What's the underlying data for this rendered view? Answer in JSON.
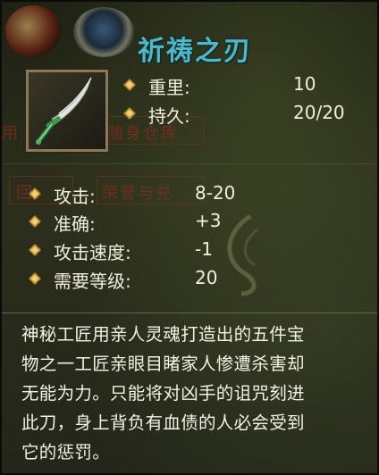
{
  "item": {
    "name": "祈祷之刃",
    "icon": "curved-blade-icon",
    "name_color": "#4fb7c8"
  },
  "top_stats": [
    {
      "label": "重里:",
      "value": "10"
    },
    {
      "label": "持久:",
      "value": "20/20"
    }
  ],
  "combat_stats": [
    {
      "label": "攻击:",
      "value": "8-20"
    },
    {
      "label": "准确:",
      "value": "+3"
    },
    {
      "label": "攻击速度:",
      "value": "-1"
    },
    {
      "label": "需要等级:",
      "value": "20"
    }
  ],
  "description": [
    "神秘工匠用亲人灵魂打造出的五件宝",
    "物之一工匠亲眼目睹家人惨遭杀害却",
    "无能为力。只能将对凶手的诅咒刻进",
    "此刀，身上背负有血债的人必会受到",
    "它的惩罚。"
  ],
  "background_ui": {
    "t1": "随身仓库",
    "t2": "用",
    "t3": "荣誉与兑",
    "t4": "回"
  },
  "colors": {
    "text": "#f2eedf",
    "gem_bullet": "#c9a040"
  }
}
